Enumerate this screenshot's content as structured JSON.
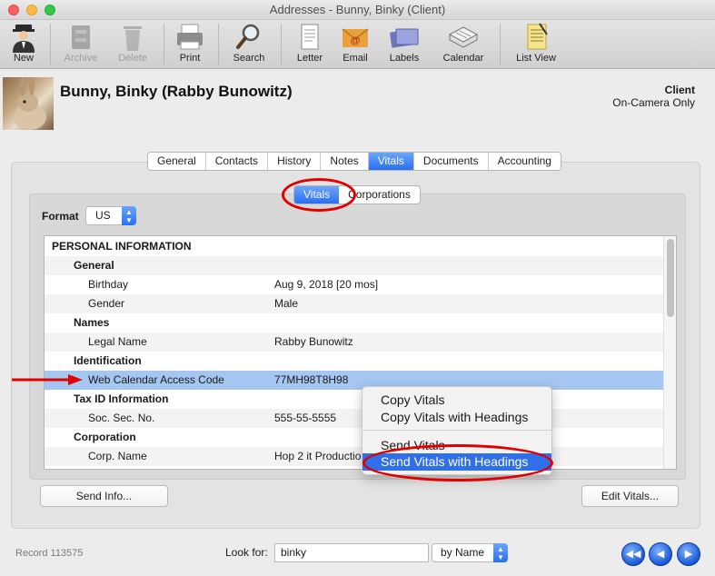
{
  "window": {
    "title": "Addresses - Bunny, Binky (Client)"
  },
  "toolbar": {
    "items": [
      {
        "label": "New",
        "icon": "new-person-icon",
        "enabled": true
      },
      {
        "label": "Archive",
        "icon": "archive-icon",
        "enabled": false
      },
      {
        "label": "Delete",
        "icon": "trash-icon",
        "enabled": false
      },
      {
        "label": "Print",
        "icon": "printer-icon",
        "enabled": true
      },
      {
        "label": "Search",
        "icon": "magnifier-icon",
        "enabled": true
      },
      {
        "label": "Letter",
        "icon": "letter-icon",
        "enabled": true
      },
      {
        "label": "Email",
        "icon": "email-icon",
        "enabled": true
      },
      {
        "label": "Labels",
        "icon": "labels-icon",
        "enabled": true
      },
      {
        "label": "Calendar",
        "icon": "calendar-icon",
        "enabled": true
      },
      {
        "label": "List View",
        "icon": "list-view-icon",
        "enabled": true
      }
    ]
  },
  "header": {
    "name": "Bunny, Binky (Rabby Bunowitz)",
    "type": "Client",
    "subtype": "On-Camera Only"
  },
  "tabs": [
    "General",
    "Contacts",
    "History",
    "Notes",
    "Vitals",
    "Documents",
    "Accounting"
  ],
  "active_tab": "Vitals",
  "subtabs": [
    "Vitals",
    "Corporations"
  ],
  "active_subtab": "Vitals",
  "format": {
    "label": "Format",
    "value": "US"
  },
  "vitals": [
    {
      "kind": "h1",
      "label": "PERSONAL INFORMATION",
      "value": ""
    },
    {
      "kind": "h2",
      "label": "General",
      "value": ""
    },
    {
      "kind": "item",
      "label": "Birthday",
      "value": "Aug 9, 2018 [20 mos]"
    },
    {
      "kind": "item",
      "label": "Gender",
      "value": "Male"
    },
    {
      "kind": "h2",
      "label": "Names",
      "value": ""
    },
    {
      "kind": "item",
      "label": "Legal Name",
      "value": "Rabby Bunowitz"
    },
    {
      "kind": "h2",
      "label": "Identification",
      "value": ""
    },
    {
      "kind": "item",
      "label": "Web Calendar Access Code",
      "value": "77MH98T8H98",
      "selected": true
    },
    {
      "kind": "h2",
      "label": "Tax ID Information",
      "value": ""
    },
    {
      "kind": "item",
      "label": "Soc. Sec. No.",
      "value": "555-55-5555"
    },
    {
      "kind": "h2",
      "label": "Corporation",
      "value": ""
    },
    {
      "kind": "item",
      "label": "Corp. Name",
      "value": "Hop 2 it Productions"
    }
  ],
  "buttons": {
    "send_info": "Send Info...",
    "edit_vitals": "Edit Vitals..."
  },
  "context_menu": {
    "items": [
      "Copy Vitals",
      "Copy Vitals with Headings",
      "Send Vitals",
      "Send Vitals with Headings"
    ],
    "highlighted": "Send Vitals with Headings"
  },
  "footer": {
    "record": "Record 113575",
    "look_for_label": "Look for:",
    "look_for_value": "binky",
    "by_option": "by Name"
  },
  "colors": {
    "accent": "#2f6fea",
    "annotation": "#e00000",
    "selected_row": "#a5c6f1"
  }
}
